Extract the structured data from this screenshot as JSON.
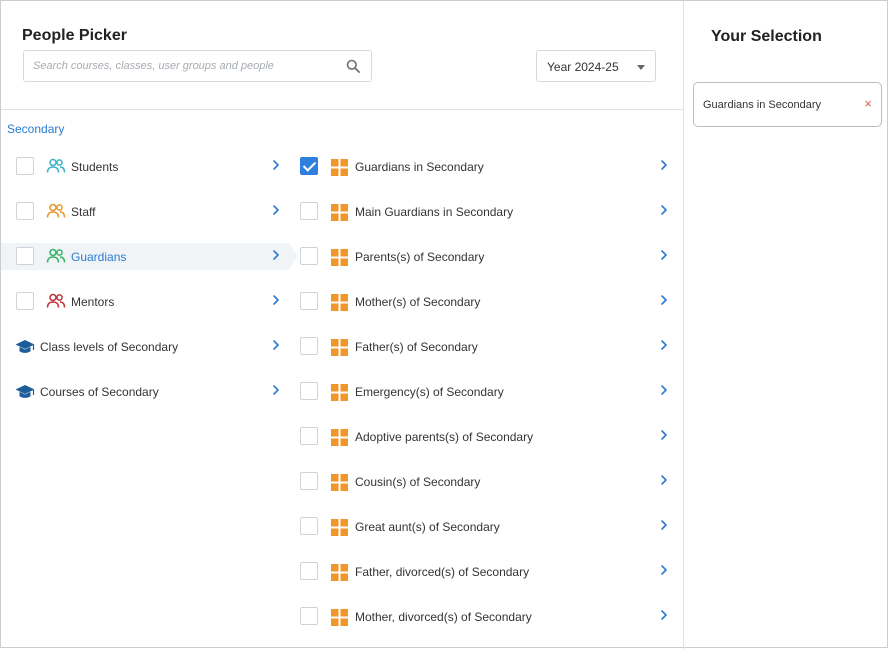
{
  "header": {
    "title": "People Picker",
    "search_placeholder": "Search courses, classes, user groups and people",
    "year_selected": "Year 2024-25"
  },
  "breadcrumb": "Secondary",
  "categories": [
    {
      "label": "Students",
      "icon": "people-icon",
      "color": "#3bb3c9"
    },
    {
      "label": "Staff",
      "icon": "people-icon",
      "color": "#e8962e"
    },
    {
      "label": "Guardians",
      "icon": "people-icon",
      "color": "#3bb36a",
      "active": true
    },
    {
      "label": "Mentors",
      "icon": "people-icon",
      "color": "#c0353d"
    },
    {
      "label": "Class levels of Secondary",
      "icon": "graduation-cap-icon",
      "color": "#1f5c9a"
    },
    {
      "label": "Courses of Secondary",
      "icon": "graduation-cap-icon",
      "color": "#1f5c9a"
    }
  ],
  "groups": [
    {
      "label": "Guardians in Secondary",
      "checked": true
    },
    {
      "label": "Main Guardians in Secondary",
      "checked": false
    },
    {
      "label": "Parents(s) of Secondary",
      "checked": false
    },
    {
      "label": "Mother(s) of Secondary",
      "checked": false
    },
    {
      "label": "Father(s) of Secondary",
      "checked": false
    },
    {
      "label": "Emergency(s) of Secondary",
      "checked": false
    },
    {
      "label": "Adoptive parents(s) of Secondary",
      "checked": false
    },
    {
      "label": "Cousin(s) of Secondary",
      "checked": false
    },
    {
      "label": "Great aunt(s) of Secondary",
      "checked": false
    },
    {
      "label": "Father, divorced(s) of Secondary",
      "checked": false
    },
    {
      "label": "Mother, divorced(s) of Secondary",
      "checked": false
    }
  ],
  "selection": {
    "title": "Your Selection",
    "items": [
      {
        "label": "Guardians in Secondary",
        "remove_label": "×"
      }
    ]
  },
  "colors": {
    "accent": "#2a7bd0",
    "checkbox_checked": "#2f7fe0",
    "group_icon": "#f0962a",
    "chevron": "#2a7bd0"
  }
}
